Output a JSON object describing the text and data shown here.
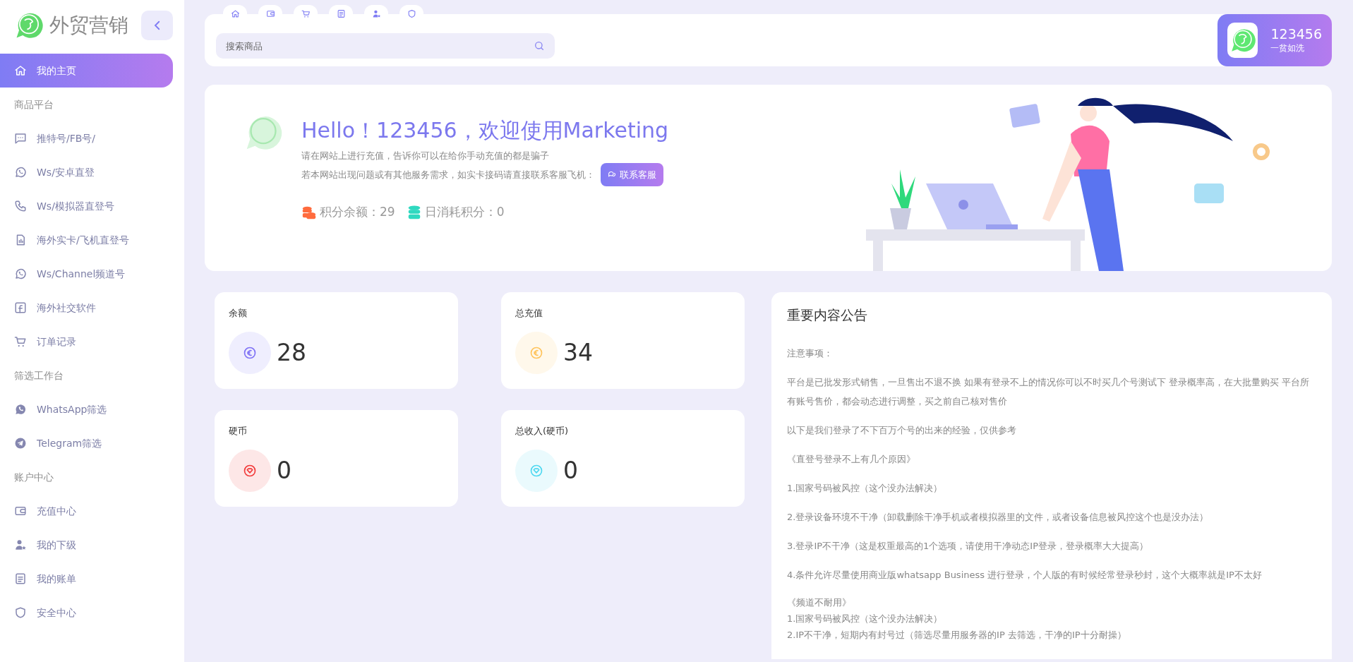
{
  "brand": {
    "name": "外贸营销"
  },
  "sidebar": {
    "items": [
      {
        "kind": "link",
        "label": "我的主页",
        "selected": true
      },
      {
        "kind": "section",
        "label": "商品平台"
      },
      {
        "kind": "link",
        "label": "推特号/FB号/",
        "selected": false
      },
      {
        "kind": "link",
        "label": "Ws/安卓直登",
        "selected": false
      },
      {
        "kind": "link",
        "label": "Ws/模拟器直登号",
        "selected": false
      },
      {
        "kind": "link",
        "label": "海外实卡/飞机直登号",
        "selected": false
      },
      {
        "kind": "link",
        "label": "Ws/Channel频道号",
        "selected": false
      },
      {
        "kind": "link",
        "label": "海外社交软件",
        "selected": false
      },
      {
        "kind": "link",
        "label": "订单记录",
        "selected": false
      },
      {
        "kind": "section",
        "label": "筛选工作台"
      },
      {
        "kind": "link",
        "label": "WhatsApp筛选",
        "selected": false
      },
      {
        "kind": "link",
        "label": "Telegram筛选",
        "selected": false
      },
      {
        "kind": "section",
        "label": "账户中心"
      },
      {
        "kind": "link",
        "label": "充值中心",
        "selected": false
      },
      {
        "kind": "link",
        "label": "我的下级",
        "selected": false
      },
      {
        "kind": "link",
        "label": "我的账单",
        "selected": false
      },
      {
        "kind": "link",
        "label": "安全中心",
        "selected": false
      }
    ]
  },
  "search": {
    "placeholder": "搜索商品"
  },
  "profile": {
    "name": "123456",
    "subtitle": "一贫如洗"
  },
  "banner": {
    "title": "Hello！123456，欢迎使用Marketing",
    "lines": [
      "请在网站上进行充值，告诉你可以在给你手动充值的都是骗子",
      "若本网站出现问题或有其他服务需求，如实卡接码请直接联系客服飞机："
    ],
    "button": "联系客服",
    "stats": [
      {
        "label": "积分余额：29",
        "color": "#ff6b3d"
      },
      {
        "label": "日消耗积分：0",
        "color": "#2fd9c0"
      }
    ]
  },
  "cards": [
    {
      "label": "余额",
      "value": "28",
      "color": "#7f72f5"
    },
    {
      "label": "总充值",
      "value": "34",
      "color": "#ffc45c"
    },
    {
      "label": "硬币",
      "value": "0",
      "color": "#f23a3a"
    },
    {
      "label": "总收入(硬币)",
      "value": "0",
      "color": "#4fd8f0"
    }
  ],
  "notice": {
    "title": "重要内容公告",
    "paragraphs": [
      {
        "lines": [
          "注意事项："
        ]
      },
      {
        "lines": [
          "平台是已批发形式销售，一旦售出不退不换 如果有登录不上的情况你可以不时买几个号测试下 登录概率高，在大批量购买 平台所有账号售价，都会动态进行调整，买之前自己核对售价"
        ]
      },
      {
        "lines": [
          "以下是我们登录了不下百万个号的出来的经验，仅供参考"
        ]
      },
      {
        "lines": [
          "《直登号登录不上有几个原因》"
        ]
      },
      {
        "lines": [
          "1.国家号码被风控（这个没办法解决）"
        ]
      },
      {
        "lines": [
          "2.登录设备环境不干净（卸载删除干净手机或者模拟器里的文件，或者设备信息被风控这个也是没办法）"
        ]
      },
      {
        "lines": [
          "3.登录IP不干净（这是权重最高的1个选项，请使用干净动态IP登录，登录概率大大提高）"
        ]
      },
      {
        "lines": [
          "4.条件允许尽量使用商业版whatsapp Business 进行登录，个人版的有时候经常登录秒封，这个大概率就是IP不太好"
        ]
      },
      {
        "lines": [
          "《频道不耐用》",
          "1.国家号码被风控（这个没办法解决）",
          "2.IP不干净，短期内有封号过（筛选尽量用服务器的IP 去筛选，干净的IP十分耐操）"
        ]
      }
    ]
  }
}
